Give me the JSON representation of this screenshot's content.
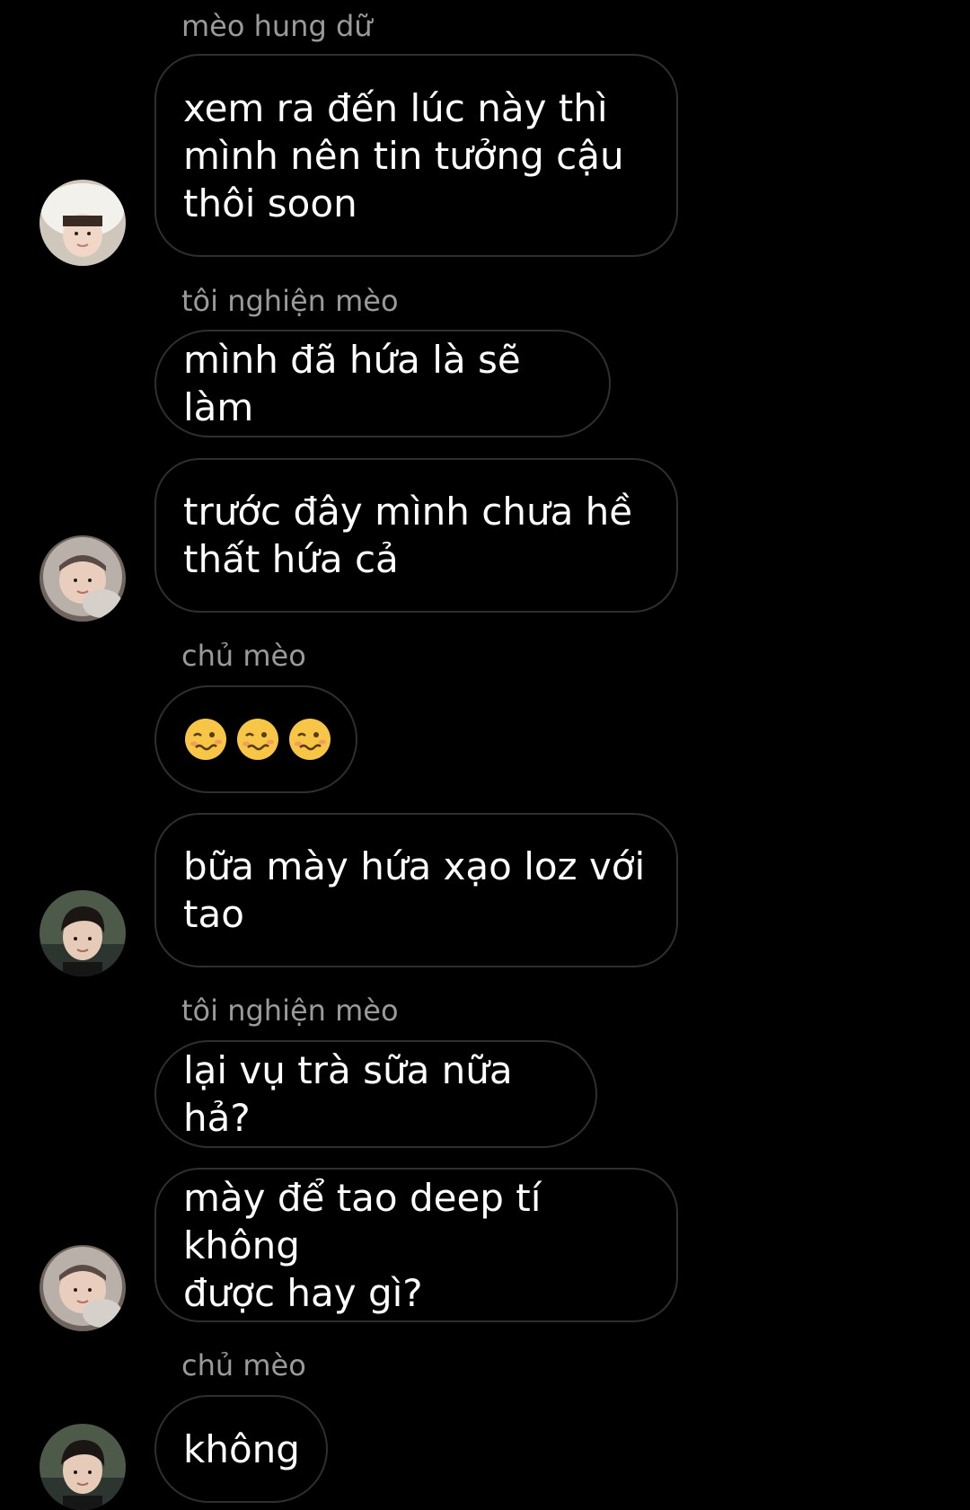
{
  "chat": {
    "messages": [
      {
        "sender": "mèo hung dữ",
        "text": "xem ra đến lúc này thì\nmình nên tin tưởng cậu\nthôi soon"
      },
      {
        "sender": "tôi nghiện mèo",
        "text": "mình đã hứa là sẽ làm"
      },
      {
        "sender": "",
        "text": "trước đây mình chưa hề\nthất hứa cả"
      },
      {
        "sender": "chủ mèo",
        "text": "🥴🥴🥴",
        "emoji": "woozy-face"
      },
      {
        "sender": "",
        "text": "bữa mày hứa xạo loz với\ntao"
      },
      {
        "sender": "tôi nghiện mèo",
        "text": "lại vụ trà sữa nữa hả?"
      },
      {
        "sender": "",
        "text": "mày để tao deep tí không\nđược hay gì?"
      },
      {
        "sender": "chủ mèo",
        "text": "không"
      }
    ],
    "avatars": [
      {
        "user": "mèo hung dữ",
        "icon": "profile-photo-white-bucket-hat"
      },
      {
        "user": "tôi nghiện mèo",
        "icon": "profile-photo-fur-hood"
      },
      {
        "user": "chủ mèo",
        "icon": "profile-photo-dark-hair"
      },
      {
        "user": "tôi nghiện mèo",
        "icon": "profile-photo-fur-hood"
      },
      {
        "user": "chủ mèo",
        "icon": "profile-photo-dark-hair"
      }
    ]
  },
  "colors": {
    "background": "#000000",
    "bubble_border": "#2f2f2f",
    "message_text": "#ffffff",
    "sender_text": "#9a9a9a",
    "emoji_yellow": "#f7c646"
  }
}
